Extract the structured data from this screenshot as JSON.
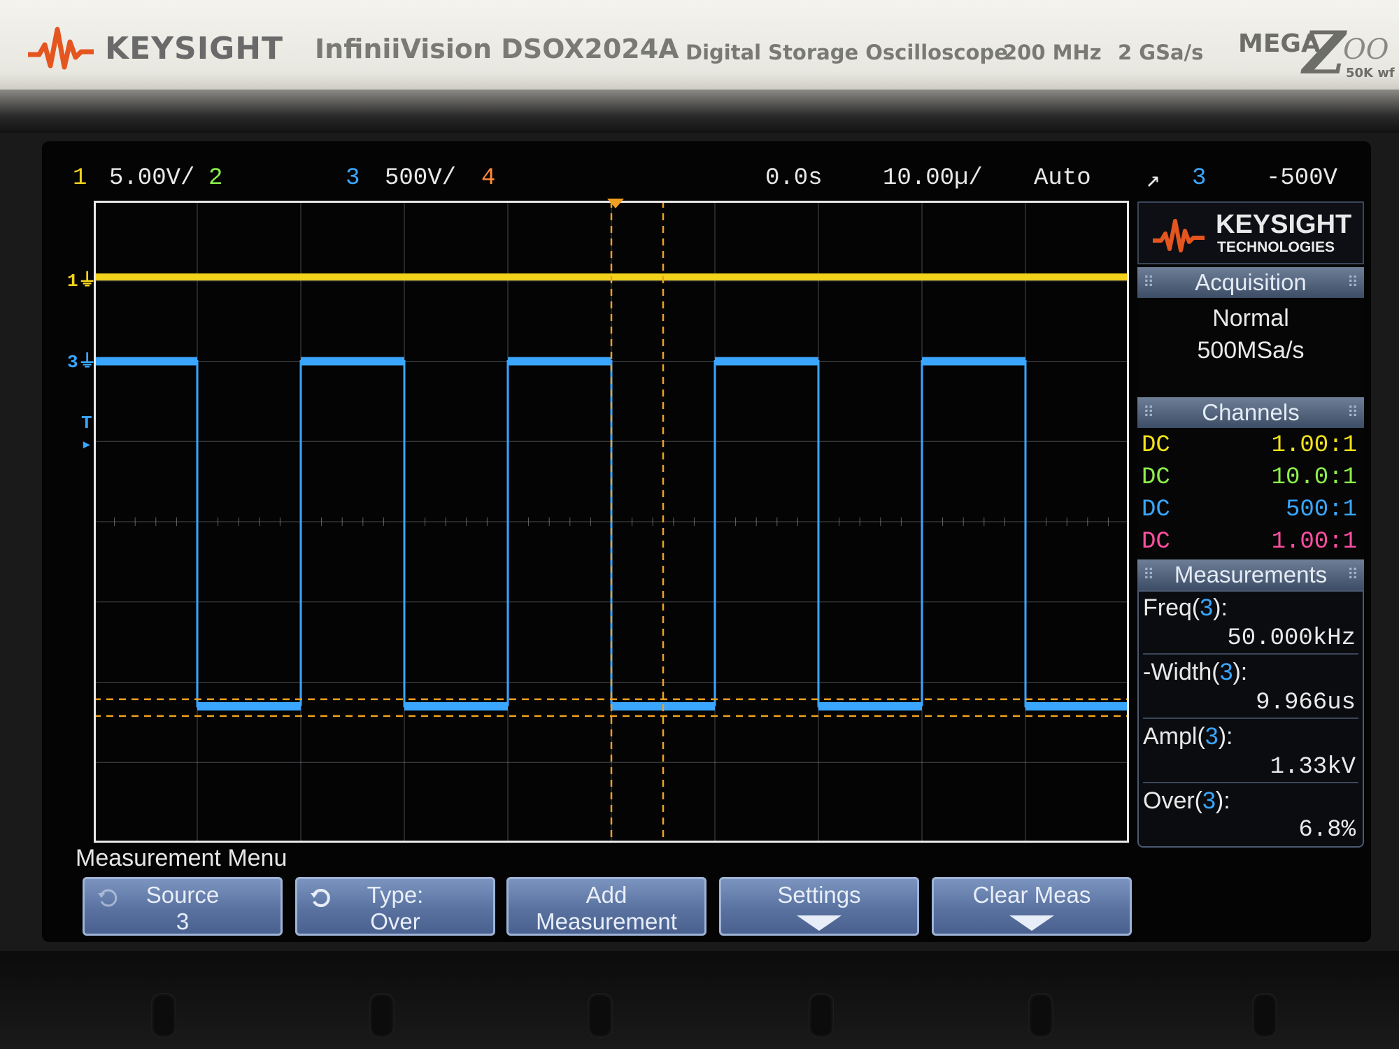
{
  "header": {
    "brand": "KEYSIGHT",
    "model": "InfiniiVision DSOX2024A",
    "description": "Digital Storage Oscilloscope",
    "bandwidth": "200 MHz",
    "sample_rate": "2 GSa/s",
    "logo_mega": "MEGA",
    "logo_zoom_z": "Z",
    "logo_zoom_rest": "OO",
    "logo_sub": "50K wf"
  },
  "statusbar": {
    "ch1_num": "1",
    "ch1_scale": "5.00V/",
    "ch2_num": "2",
    "ch3_num": "3",
    "ch3_scale": "500V/",
    "ch4_num": "4",
    "time_delay": "0.0s",
    "time_scale": "10.00µ/",
    "trigger_mode": "Auto",
    "trigger_slope": "↗",
    "trigger_source": "3",
    "trigger_level": "-500V"
  },
  "markers": {
    "ch1": "1",
    "ch3": "3",
    "trigger": "T"
  },
  "panel": {
    "logo_line1": "KEYSIGHT",
    "logo_line2": "TECHNOLOGIES",
    "acquisition": {
      "title": "Acquisition",
      "mode": "Normal",
      "rate": "500MSa/s"
    },
    "channels": {
      "title": "Channels",
      "rows": [
        {
          "coupling": "DC",
          "probe": "1.00:1",
          "color": "#f2e21a"
        },
        {
          "coupling": "DC",
          "probe": "10.0:1",
          "color": "#8cf04a"
        },
        {
          "coupling": "DC",
          "probe": "500:1",
          "color": "#3aa6ff"
        },
        {
          "coupling": "DC",
          "probe": "1.00:1",
          "color": "#ff4fa3"
        }
      ]
    },
    "measurements": {
      "title": "Measurements",
      "items": [
        {
          "name_a": "Freq(",
          "src": "3",
          "name_b": "):",
          "value": "50.000kHz"
        },
        {
          "name_a": "-Width(",
          "src": "3",
          "name_b": "):",
          "value": "9.966us"
        },
        {
          "name_a": "Ampl(",
          "src": "3",
          "name_b": "):",
          "value": "1.33kV"
        },
        {
          "name_a": "Over(",
          "src": "3",
          "name_b": "):",
          "value": "6.8%"
        }
      ]
    }
  },
  "menu": {
    "title": "Measurement Menu",
    "softkeys": [
      {
        "line1": "Source",
        "line2": "3"
      },
      {
        "line1": "Type:",
        "line2": "Over"
      },
      {
        "line1": "Add",
        "line2": "Measurement"
      },
      {
        "line1": "Settings",
        "line2": ""
      },
      {
        "line1": "Clear Meas",
        "line2": ""
      }
    ]
  },
  "colors": {
    "ch1": "#f2d21a",
    "ch2": "#8cf04a",
    "ch3": "#3aa6ff",
    "ch4": "#ff8a3a",
    "cursor": "#f0a020",
    "grid": "#9aa0a8"
  },
  "waveform": {
    "ch3_frequency_khz": 50,
    "ch3_period_divisions": 2,
    "ch3_duty_fraction": 0.5,
    "ch1_level_div": 3.05,
    "ch3_high_div": 2.0,
    "ch3_low_div": -2.3
  }
}
